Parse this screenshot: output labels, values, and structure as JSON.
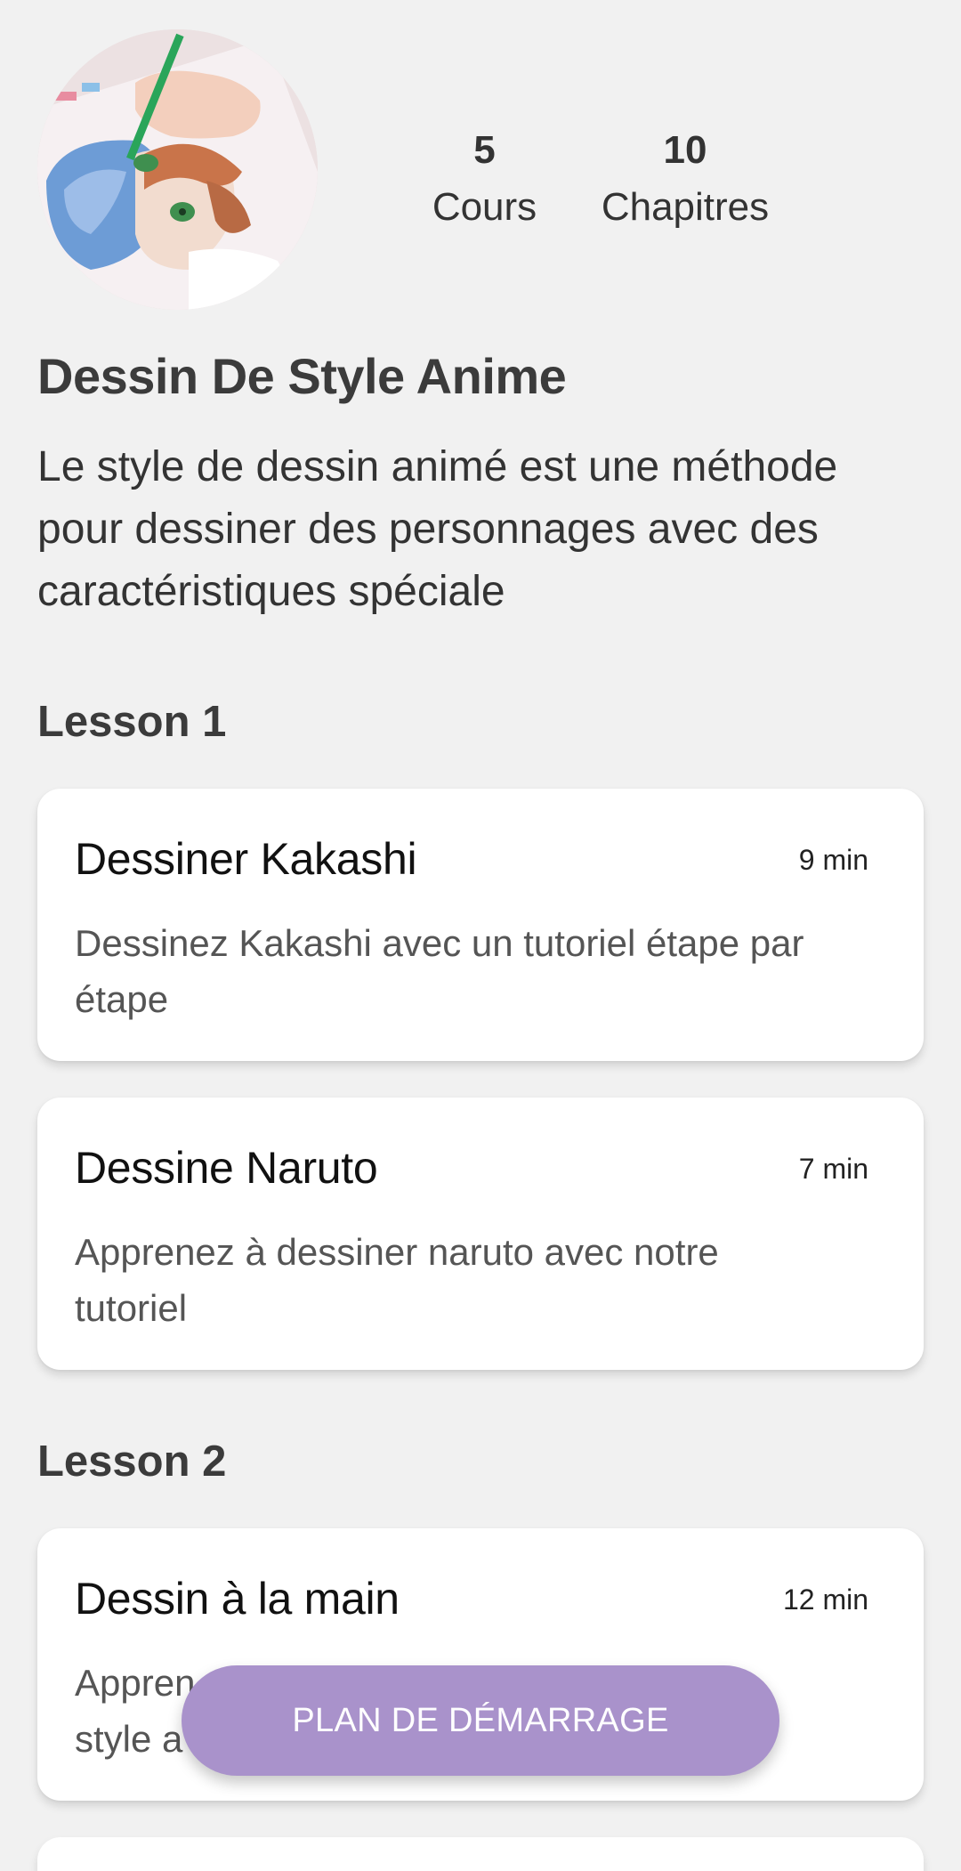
{
  "header": {
    "avatar_icon": "anime-drawing-photo",
    "stats": [
      {
        "value": "5",
        "label": "Cours"
      },
      {
        "value": "10",
        "label": "Chapitres"
      }
    ]
  },
  "course": {
    "title": "Dessin De Style Anime",
    "description": "Le style de dessin animé est une méthode pour dessiner des personnages avec des caractéristiques spéciale"
  },
  "lessons": [
    {
      "heading": "Lesson 1",
      "chapters": [
        {
          "title": "Dessiner Kakashi",
          "duration": "9 min",
          "description": "Dessinez Kakashi avec un tutoriel étape par étape"
        },
        {
          "title": "Dessine Naruto",
          "duration": "7 min",
          "description": "Apprenez à dessiner naruto avec notre tutoriel"
        }
      ]
    },
    {
      "heading": "Lesson 2",
      "chapters": [
        {
          "title": "Dessin à la main",
          "duration": "12 min",
          "description_line1": "Appren",
          "description_line2": "style a"
        }
      ]
    }
  ],
  "cta": {
    "label": "PLAN DE DÉMARRAGE",
    "color": "#a992cb"
  },
  "colors": {
    "background": "#f1f1f1",
    "card": "#ffffff"
  }
}
